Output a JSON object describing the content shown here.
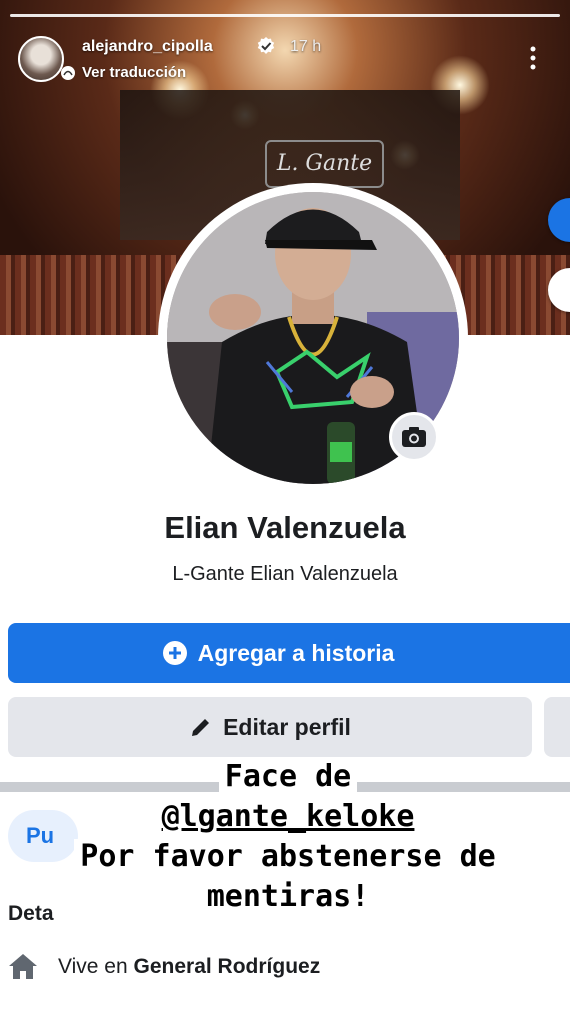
{
  "story": {
    "username": "alejandro_cipolla",
    "time": "17 h",
    "translate_label": "Ver traducción"
  },
  "cover": {
    "sign_text": "L. Gante"
  },
  "profile": {
    "name": "Elian Valenzuela",
    "alternate_name": "L-Gante Elian Valenzuela",
    "add_story_label": "Agregar a historia",
    "edit_profile_label": "Editar perfil",
    "chip_label": "Pu",
    "details_title": "Deta",
    "lives_in_prefix": "Vive en ",
    "lives_in_place": "General Rodríguez"
  },
  "overlay_text": {
    "line1": "Face de",
    "line2": "@lgante_keloke",
    "line3": "Por favor abstenerse de",
    "line4": "mentiras!"
  },
  "colors": {
    "facebook_blue": "#1b74e4",
    "button_gray": "#e4e6eb",
    "text_dark": "#1c1e21"
  },
  "icons": [
    "verified-badge-icon",
    "translate-icon",
    "more-options-icon",
    "camera-icon",
    "plus-circle-icon",
    "pencil-icon",
    "home-icon"
  ]
}
